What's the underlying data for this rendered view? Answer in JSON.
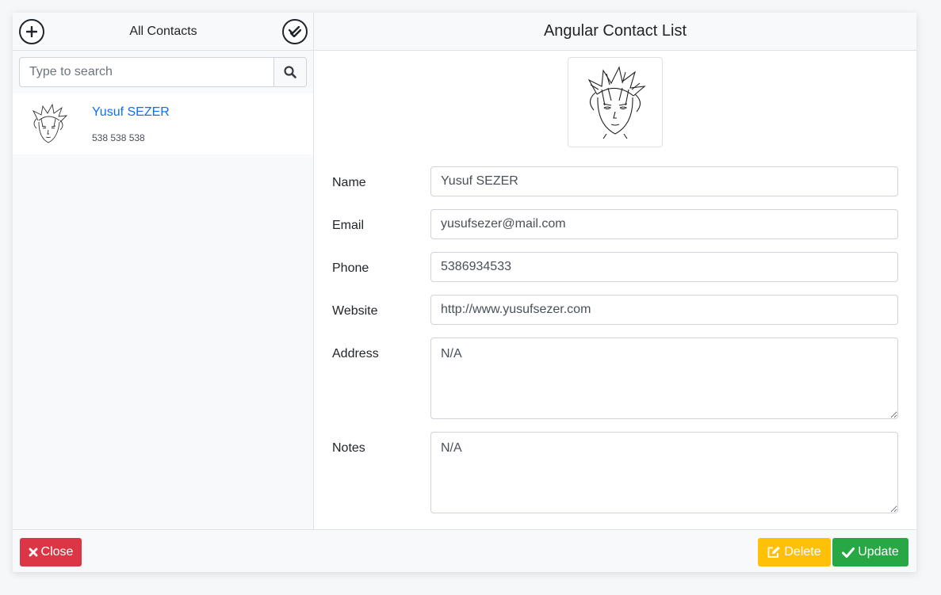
{
  "sidebar": {
    "title": "All Contacts",
    "add_icon": "plus-circle-icon",
    "select_all_icon": "double-check-icon",
    "search": {
      "placeholder": "Type to search",
      "value": "",
      "icon": "search-icon"
    },
    "contacts": [
      {
        "name": "Yusuf SEZER",
        "phone": "538 538 538",
        "avatar": "anime-sketch-avatar"
      }
    ]
  },
  "main": {
    "title": "Angular Contact List",
    "avatar": "anime-sketch-avatar",
    "fields": {
      "name": {
        "label": "Name",
        "value": "Yusuf SEZER"
      },
      "email": {
        "label": "Email",
        "value": "yusufsezer@mail.com"
      },
      "phone": {
        "label": "Phone",
        "value": "5386934533"
      },
      "website": {
        "label": "Website",
        "value": "http://www.yusufsezer.com"
      },
      "address": {
        "label": "Address",
        "value": "N/A"
      },
      "notes": {
        "label": "Notes",
        "value": "N/A"
      }
    }
  },
  "footer": {
    "close_label": "Close",
    "delete_label": "Delete",
    "update_label": "Update",
    "close_icon": "x-icon",
    "delete_icon": "edit-icon",
    "update_icon": "check-icon"
  },
  "colors": {
    "close": "#dc3545",
    "delete": "#ffc107",
    "update": "#28a745",
    "link": "#0d6efd"
  }
}
